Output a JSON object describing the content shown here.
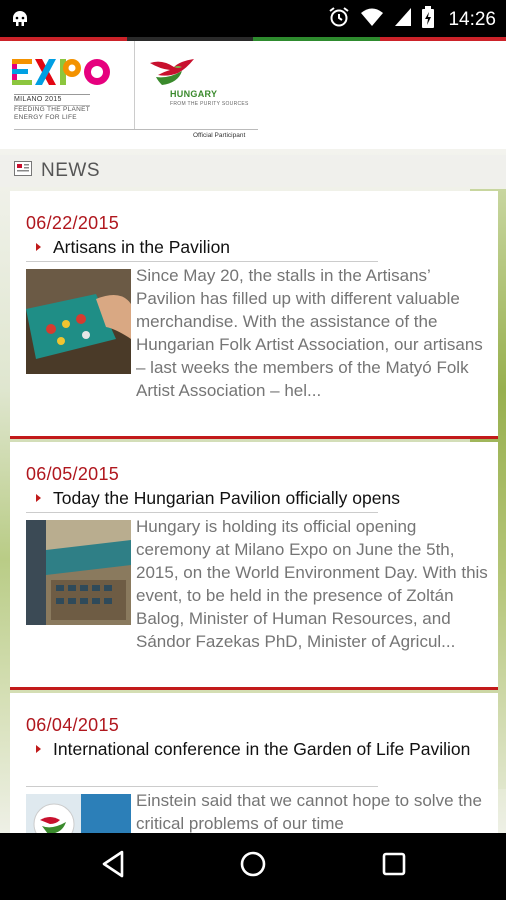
{
  "status_bar": {
    "time": "14:26",
    "icons": [
      "android-icon",
      "alarm-icon",
      "wifi-icon",
      "signal-icon",
      "battery-icon"
    ]
  },
  "header": {
    "expo_logo_text": "EXPO",
    "expo_sub_line1": "MILANO 2015",
    "expo_sub_line2": "FEEDING THE PLANET",
    "expo_sub_line3": "ENERGY FOR LIFE",
    "hungary_text": "HUNGARY",
    "hungary_sub": "FROM THE PURITY SOURCES",
    "official_participant": "Official Participant",
    "flag_colors": [
      "#cc2229",
      "#ffffff",
      "#2e8b2e"
    ]
  },
  "news": {
    "section_title": "NEWS",
    "items": [
      {
        "date": "06/22/2015",
        "title": "Artisans in the Pavilion",
        "excerpt": "Since May 20, the stalls in the Artisans’ Pavilion has filled up with different valuable merchandise. With the assistance of the Hungarian Folk Artist Association, our artisans – last weeks the members of the Matyó Folk Artist Association – hel..."
      },
      {
        "date": "06/05/2015",
        "title": "Today the Hungarian Pavilion officially opens",
        "excerpt": "Hungary is holding its official opening ceremony at Milano Expo on June the 5th, 2015, on the World Environment Day. With this event, to be held in the presence of Zoltán Balog, Minister of Human Resources, and Sándor Fazekas PhD, Minister of Agricul..."
      },
      {
        "date": "06/04/2015",
        "title": "International conference in the Garden of Life Pavilion",
        "excerpt": "Einstein said that we cannot hope to solve the critical problems of our time"
      }
    ]
  },
  "nav": {
    "back": "back-icon",
    "home": "home-icon",
    "recents": "recents-icon"
  }
}
